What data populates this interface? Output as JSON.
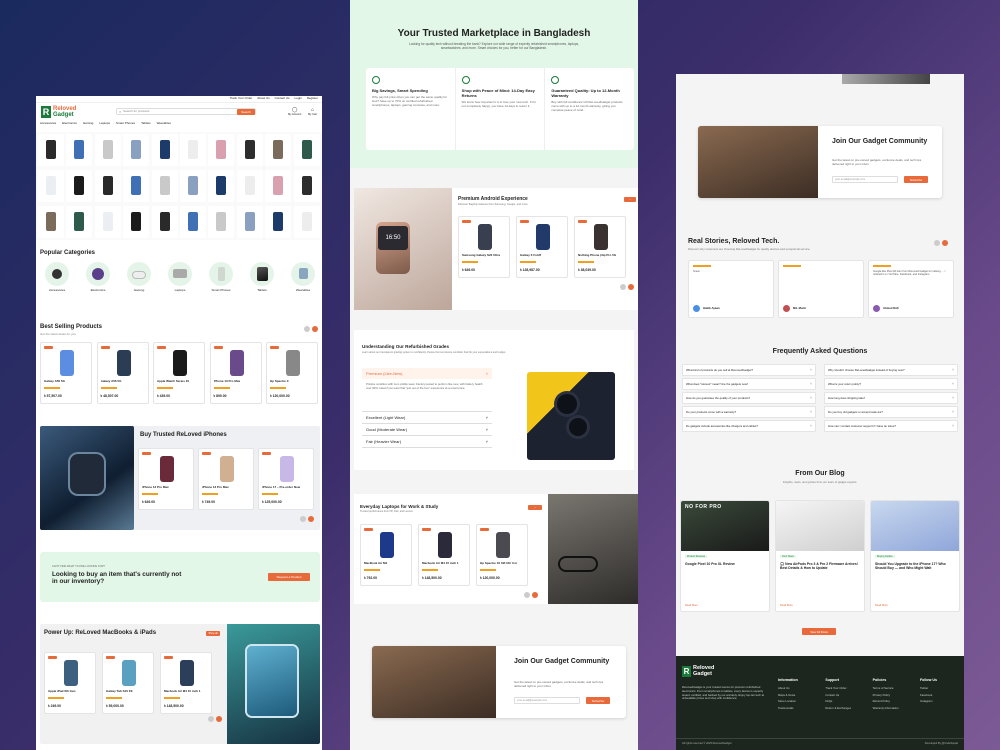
{
  "p1": {
    "topbar": [
      "Track Your Order",
      "About Us",
      "Contact Us",
      "Login",
      "Register"
    ],
    "logo": [
      "Reloved",
      "Gadget"
    ],
    "search_placeholder": "Search for products",
    "search_button": "Search",
    "account": "My Account",
    "cart": "My Cart",
    "nav": [
      "Accessories",
      "Electronics",
      "Gaming",
      "Laptops",
      "Smart Phones",
      "Tablets",
      "Wearables"
    ],
    "popular_title": "Popular Categories",
    "categories": [
      "Accessories",
      "Electronics",
      "Gaming",
      "Laptops",
      "Smart Phones",
      "Tablets",
      "Wearables"
    ],
    "best_title": "Best Selling Products",
    "best_sub": "Get the latest deals for you",
    "best_products": [
      {
        "name": "Galaxy A56 5G",
        "price": "৳ 57,507.00"
      },
      {
        "name": "Galaxy A56 5G",
        "price": "৳ 48,507.00"
      },
      {
        "name": "Apple Watch Series 10",
        "price": "৳ 439.00"
      },
      {
        "name": "iPhone 13 Pro Max",
        "price": "৳ 890.00"
      },
      {
        "name": "Hp Spectre X",
        "price": "৳ 120,000.00"
      }
    ],
    "iphones_title": "Buy Trusted ReLoved iPhones",
    "iphones": [
      {
        "name": "iPhone 13 Pro Max",
        "price": "৳ 649.00"
      },
      {
        "name": "iPhone 13 Pro Max",
        "price": "৳ 749.00"
      },
      {
        "name": "iPhone 17 – Pre-order Now",
        "price": "৳ 125,000.00"
      }
    ],
    "request_kicker": "CAN'T FIND WHAT YOU'RE LOOKING FOR?",
    "request_title": "Looking to buy an item that's currently not in our inventory?",
    "request_button": "Request a Product",
    "power_title": "Power Up: ReLoved MacBooks & iPads",
    "power_button": "Shop all",
    "power": [
      {
        "name": "Apple iPad 6th Gen",
        "price": "৳ 249.00"
      },
      {
        "name": "Galaxy Tab S10 FE",
        "price": "৳ 59,000.00"
      },
      {
        "name": "Macbook Air M4 15 inch 1",
        "price": "৳ 148,500.00"
      }
    ]
  },
  "p2": {
    "hero_title": "Your Trusted Marketplace in Bangladesh",
    "hero_sub": "Looking for quality tech without breaking the bank? Explore our wide range of expertly refurbished smartphones, laptops, smartwatches, and more. Smart choices for you, better for our Bangladesh.",
    "features": [
      {
        "title": "Big Savings, Smart Spending",
        "text": "Why pay full price when you can get the same quality for less? Save up to 70% on certified refurbished smartphones, laptops, gaming consoles, and more."
      },
      {
        "title": "Shop with Peace of Mind: 14-Day Easy Returns",
        "text": "We know how important it is to love your new tech. If it's not completely happy, you have 14 days to return it."
      },
      {
        "title": "Guaranteed Quality: Up to 12-Month Warranty",
        "text": "Buy with full confidence! All ReLovedGadget products come with up to a 12-month warranty, giving you complete peace of mind."
      }
    ],
    "android_title": "Premium Android Experience",
    "android_sub": "Discover flagship features from Samsung, Google, and more",
    "android": [
      {
        "name": "Samsung Galaxy S22 Ultra",
        "price": "৳ 649.00"
      },
      {
        "name": "Galaxy Z Fold7",
        "price": "৳ 128,987.00"
      },
      {
        "name": "Nothing Phone (3a) Pro 5G",
        "price": "৳ 38,039.00"
      }
    ],
    "phone_time": "16:50",
    "grades_title": "Understanding Our Refurbished Grades",
    "grades_sub": "Learn about our transparent grading system to confidently choose the best device condition that fits your expectations and budget.",
    "grades": [
      "Premium (Like-New)",
      "Excellent (Light Wear)",
      "Good (Moderate Wear)",
      "Fair (Heavier Wear)"
    ],
    "grade_text": "Pristine condition with zero visible wear. Factory-tested to perform like new, with battery health over 90%. Ideal if you want that \"just out of the box\" experience at a smart price.",
    "laptops_title": "Everyday Laptops for Work & Study",
    "laptops_sub": "Trusted performance from HP, Dell, and Lenovo",
    "laptops": [
      {
        "name": "MacBook Air M4",
        "price": "৳ 792.00"
      },
      {
        "name": "Macbook Air M4 15 inch 1",
        "price": "৳ 148,500.00"
      },
      {
        "name": "Hp Spectre 16 X2I Ultr Cor",
        "price": "৳ 120,000.00"
      }
    ],
    "join_title": "Join Our Gadget Community",
    "join_text": "Get the latest on pre-owned gadgets, exclusive deals, and tech tips delivered right to your inbox.",
    "email_placeholder": "your-email@example.com",
    "subscribe": "Subscribe"
  },
  "p3": {
    "join_title": "Join Our Gadget Community",
    "join_text": "Get the latest on pre-owned gadgets, exclusive deals, and tech tips delivered right to your inbox.",
    "email_placeholder": "your-email@example.com",
    "subscribe": "Subscribe",
    "stories_title": "Real Stories, Reloved Tech.",
    "stories_sub": "Discover why customers are choosing ReLovedGadget for quality devices and exceptional service.",
    "reviews": [
      {
        "text": "Great",
        "name": "Habib Ayaan"
      },
      {
        "text": "",
        "name": "Md. Munir"
      },
      {
        "text": "Google like Pixel 9A Gen from ReLoved Gadget for valuing … I ordered it on YouTube, Facebook, and Instagram.",
        "name": "Ahmed Rafi"
      }
    ],
    "faq_title": "Frequently Asked Questions",
    "faq_left": [
      "What kind of products do you sell at ReLovedGadget?",
      "What does \"reloved\" mean? Are the gadgets new?",
      "How do you guarantee the quality of your products?",
      "Do your products come with a warranty?",
      "Do gadgets include accessories like chargers and cables?"
    ],
    "faq_right": [
      "Why should I choose ReLovedGadget instead of buying new?",
      "What is your return policy?",
      "How long does shipping take?",
      "Do you buy old gadgets or accept trade-ins?",
      "How can I contact customer support if I have an issue?"
    ],
    "blog_title": "From Our Blog",
    "blog_sub": "Insights, news, and guides from our team of gadget experts.",
    "blog": [
      {
        "tag": "Product Reviews",
        "title": "Google Pixel 10 Pro XL Review",
        "img": "NO FOR PRO"
      },
      {
        "tag": "Tech News",
        "title": "🎧 New AirPods Pro 3 & Pro 2 Firmware Arrives! Best Details & How to Update"
      },
      {
        "tag": "Buying Guides",
        "title": "Should You Upgrade to the iPhone 17? Who Should Buy — and Who Might Wait"
      }
    ],
    "read_more": "Read More",
    "view_all": "View All Posts",
    "footer_about": "ReLovedGadget is your trusted source for premium refurbished electronics. From smartphones to tablets, every device is expertly tested, certified, and backed by our warranty. Enjoy top-tier tech at unbeatable prices and shop with confidence.",
    "footer_cols": [
      {
        "title": "Information",
        "items": [
          "About Us",
          "Maps & News",
          "Store Location",
          "Testimonials"
        ]
      },
      {
        "title": "Support",
        "items": [
          "Track Your Order",
          "Contact Us",
          "FAQs",
          "Return & Exchanges"
        ]
      },
      {
        "title": "Policies",
        "items": [
          "Terms of Service",
          "Privacy Policy",
          "Refund Policy",
          "Warranty Information"
        ]
      },
      {
        "title": "Follow Us",
        "items": [
          "Twitter",
          "Facebook",
          "Instagram"
        ]
      }
    ],
    "copyright": "All rights reserved © 2025 ReLovedGadget",
    "dev": "Developed By @CodeSquad"
  },
  "colors": {
    "accent": "#e86a3a",
    "green": "#1b7a3a",
    "mint": "#e3f7e8"
  }
}
